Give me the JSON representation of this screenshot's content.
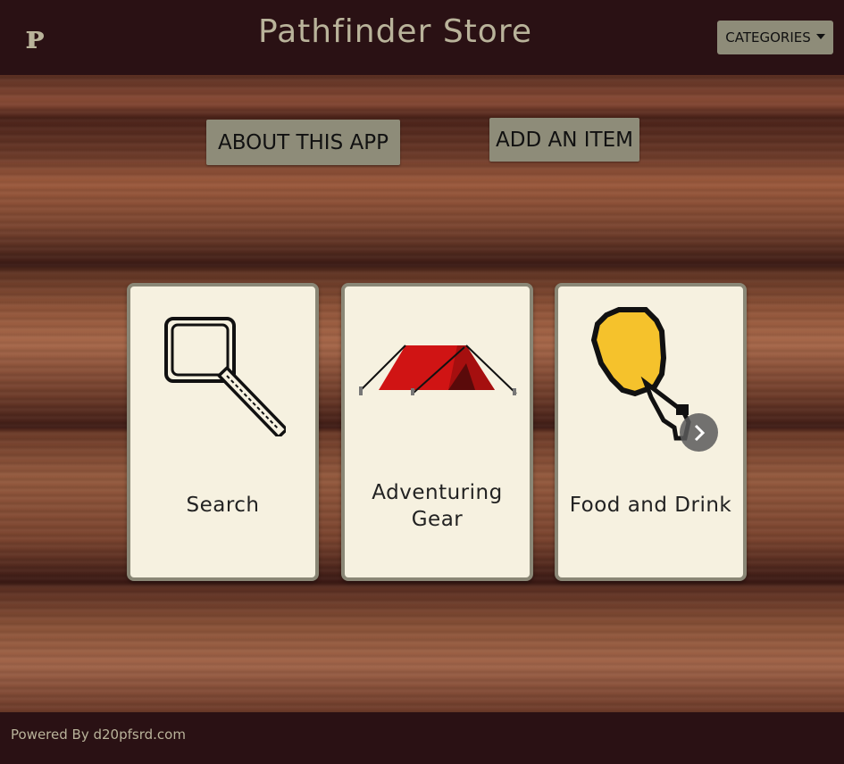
{
  "navbar": {
    "logo": "ᴘ",
    "title": "Pathfinder Store",
    "categories_label": "CATEGORIES"
  },
  "actions": {
    "about_label": "ABOUT THIS APP",
    "add_label": "ADD AN ITEM"
  },
  "cards": [
    {
      "label": "Search",
      "icon": "magnifying-glass-icon"
    },
    {
      "label_line1": "Adventuring",
      "label_line2": "Gear",
      "icon": "tent-icon"
    },
    {
      "label": "Food and Drink",
      "icon": "drumstick-icon"
    }
  ],
  "footer": {
    "text": "Powered By d20pfsrd.com"
  },
  "colors": {
    "navbar_bg": "#2a1114",
    "accent_text": "#b9b39a",
    "button_bg": "#8e8c79",
    "card_bg": "#f6f1e0"
  }
}
